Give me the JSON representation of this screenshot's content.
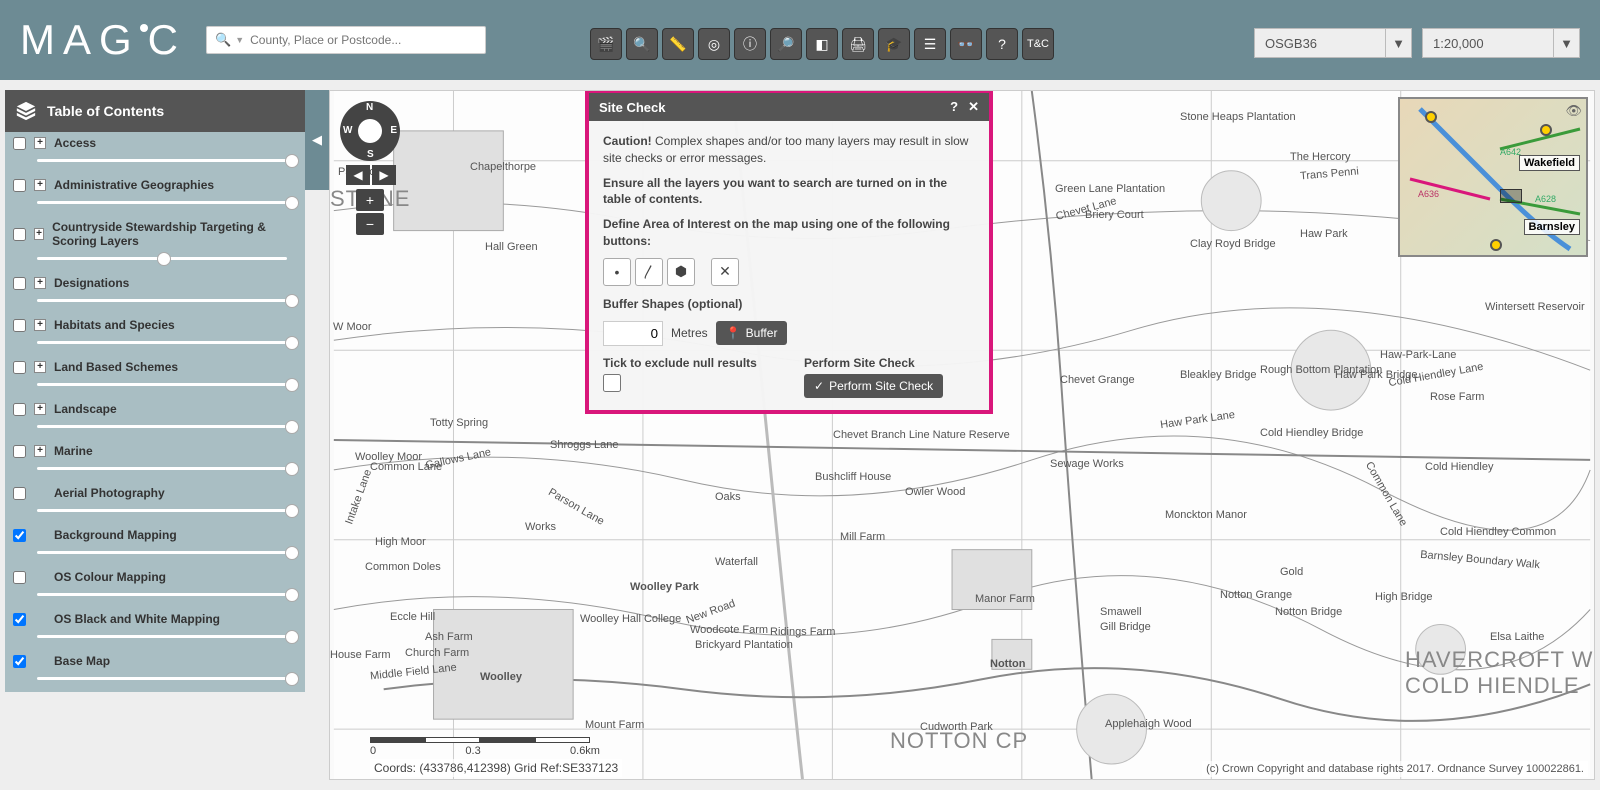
{
  "header": {
    "logo_text": "MAGIC",
    "search_placeholder": "County, Place or Postcode...",
    "projection": "OSGB36",
    "scale": "1:20,000",
    "tool_icons": [
      "film-icon",
      "search-zoom-icon",
      "ruler-icon",
      "target-icon",
      "info-icon",
      "identify-icon",
      "eraser-icon",
      "print-icon",
      "graduation-icon",
      "list-icon",
      "binoculars-icon",
      "help-icon",
      "tc-icon"
    ]
  },
  "toc": {
    "title": "Table of Contents",
    "items": [
      {
        "label": "Access",
        "checked": false,
        "expandable": true,
        "thumb": 268
      },
      {
        "label": "Administrative Geographies",
        "checked": false,
        "expandable": true,
        "thumb": 268
      },
      {
        "label": "Countryside Stewardship Targeting & Scoring Layers",
        "checked": false,
        "expandable": true,
        "thumb": 140
      },
      {
        "label": "Designations",
        "checked": false,
        "expandable": true,
        "thumb": 268
      },
      {
        "label": "Habitats and Species",
        "checked": false,
        "expandable": true,
        "thumb": 268
      },
      {
        "label": "Land Based Schemes",
        "checked": false,
        "expandable": true,
        "thumb": 268
      },
      {
        "label": "Landscape",
        "checked": false,
        "expandable": true,
        "thumb": 268
      },
      {
        "label": "Marine",
        "checked": false,
        "expandable": true,
        "thumb": 268
      },
      {
        "label": "Aerial Photography",
        "checked": false,
        "expandable": false,
        "thumb": 268
      },
      {
        "label": "Background Mapping",
        "checked": true,
        "expandable": false,
        "thumb": 268
      },
      {
        "label": "OS Colour Mapping",
        "checked": false,
        "expandable": false,
        "thumb": 268
      },
      {
        "label": "OS Black and White Mapping",
        "checked": true,
        "expandable": false,
        "thumb": 268
      },
      {
        "label": "Base Map",
        "checked": true,
        "expandable": false,
        "thumb": 268
      }
    ]
  },
  "sitecheck": {
    "title": "Site Check",
    "caution_prefix": "Caution!",
    "caution_text": " Complex shapes and/or too many layers may result in slow site checks or error messages.",
    "ensure_text": "Ensure all the layers you want to search are turned on in the table of contents.",
    "define_text": "Define Area of Interest on the map using one of the following buttons:",
    "buffer_label": "Buffer Shapes (optional)",
    "buffer_value": "0",
    "buffer_unit": "Metres",
    "buffer_btn": "Buffer",
    "null_label": "Tick to exclude null results",
    "perform_label": "Perform Site Check",
    "perform_btn": "Perform Site Check"
  },
  "map": {
    "coords_text": "Coords: (433786,412398) Grid Ref:SE337123",
    "copyright_text": "(c) Crown Copyright and database rights 2017. Ordnance Survey 100022861.",
    "scale_labels": [
      "0",
      "0.3",
      "0.6km"
    ],
    "overview_cities": [
      "Wakefield",
      "Barnsley"
    ],
    "overview_roads": [
      "A642",
      "A636",
      "A628"
    ],
    "place_labels": {
      "painthorpe": "Painthorpe",
      "chapelthorpe": "Chapelthorpe",
      "hallgreen": "Hall Green",
      "wmoor": "W Moor",
      "woolleymoor": "Woolley Moor",
      "gallowslane": "Gallows Lane",
      "commonlane": "Common Lane",
      "highmoor": "High Moor",
      "commondoles": "Common Doles",
      "ecclehill": "Eccle Hill",
      "ashfarm": "Ash Farm",
      "churchfarm": "Church Farm",
      "middlefieldlane": "Middle Field Lane",
      "woolley": "Woolley",
      "woolleypark": "Woolley Park",
      "woolleyhall": "Woolley Hall College",
      "tottyspring": "Totty Spring",
      "oaks": "Oaks",
      "bushcliff": "Bushcliff House",
      "owlerwood": "Owler Wood",
      "millfarm": "Mill Farm",
      "woodcote": "Woodcote Farm",
      "brickyard": "Brickyard Plantation",
      "newroad": "New Road",
      "ridingsfarm": "Ridings Farm",
      "waterfall": "Waterfall",
      "manorfarm": "Manor Farm",
      "notton": "Notton",
      "nottoncp": "NOTTON CP",
      "sewageworks": "Sewage Works",
      "monckton": "Monckton Manor",
      "applehaigh": "Applehaigh Wood",
      "cudworthpark": "Cudworth Park",
      "chevetgrange": "Chevet Grange",
      "chevetbranch": "Chevet Branch Line Nature Reserve",
      "chevetlane": "Chevet Lane",
      "brierycourt": "Briery Court",
      "greenlane": "Green Lane Plantation",
      "stoneheaps": "Stone Heaps Plantation",
      "hercory": "The Hercory",
      "transpenine": "Trans Penni",
      "hawpark": "Haw Park",
      "hawparklane": "Haw Park Lane",
      "bleakley": "Bleakley Bridge",
      "roughbottom": "Rough Bottom Plantation",
      "clayroyd": "Clay Royd Bridge",
      "smawell": "Smawell",
      "nottongrange": "Notton Grange",
      "nottonbridge": "Notton Bridge",
      "gillbridge": "Gill Bridge",
      "hawparkbridge": "Haw Park Bridge",
      "gold": "Gold",
      "highbridge": "High Bridge",
      "elsalaithe": "Elsa Laithe",
      "wintersett": "Wintersett Reservoir",
      "hawparklane2": "Haw-Park-Lane",
      "coldhiendleylane": "Cold Hiendley Lane",
      "coldhiendleybridge": "Cold Hiendley Bridge",
      "coldhiendley": "Cold Hiendley",
      "coldhiendleycommon": "Cold Hiendley Common",
      "commonlane2": "Common Lane",
      "rosefarm": "Rose Farm",
      "barnsleyboundary": "Barnsley Boundary Walk",
      "havercroft": "HAVERCROFT W",
      "coldhiendlebig": "COLD HIENDLE",
      "mountfarm": "Mount Farm",
      "shroggs": "Shroggs Lane",
      "parsons": "Parson Lane",
      "works": "Works",
      "stone": "STONE",
      "housefarm": "House Farm",
      "ingslane": "Intake Lane"
    }
  },
  "nav": {
    "dirs": {
      "n": "N",
      "e": "E",
      "s": "S",
      "w": "W"
    }
  }
}
